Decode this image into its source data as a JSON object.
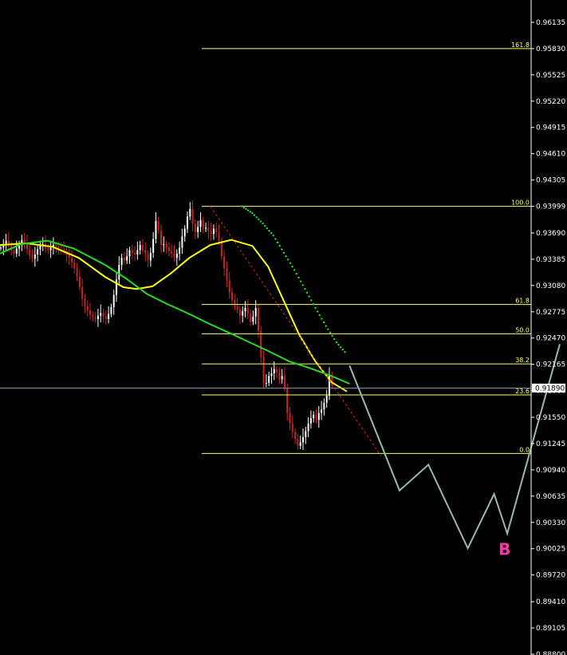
{
  "chart_data": {
    "type": "line",
    "title": "",
    "ylim": [
      0.8879,
      0.9644
    ],
    "xlim": [
      0,
      140
    ],
    "grid": false,
    "colors": {
      "background": "#000000",
      "axis": "#ffffff",
      "candle_up": "#ffffff",
      "candle_down": "#cc2222",
      "ma_yellow": "#ffff00",
      "ma_green": "#22dd22",
      "fib": "#ffff66",
      "projection": "#99bbaa",
      "trendline": "#cc2222",
      "current_price_line": "#8899bb",
      "wave_label": "#ff33aa"
    },
    "y_ticks": [
      "0.96135",
      "0.95830",
      "0.95525",
      "0.95220",
      "0.94915",
      "0.94610",
      "0.94305",
      "0.93999",
      "0.93690",
      "0.93385",
      "0.93080",
      "0.92775",
      "0.92470",
      "0.92165",
      "0.91860",
      "0.91550",
      "0.91245",
      "0.90940",
      "0.90635",
      "0.90330",
      "0.90025",
      "0.89720",
      "0.89410",
      "0.89105",
      "0.88800"
    ],
    "current_price": {
      "label": "0.91890",
      "value": 0.9189
    },
    "fib_levels": [
      {
        "label": "161.8",
        "value": 0.9583
      },
      {
        "label": "100.0",
        "value": 0.93999
      },
      {
        "label": "61.8",
        "value": 0.9286
      },
      {
        "label": "50.0",
        "value": 0.9252
      },
      {
        "label": "38.2",
        "value": 0.9217
      },
      {
        "label": "23.6",
        "value": 0.9181
      },
      {
        "label": "0.0",
        "value": 0.9113
      }
    ],
    "fib_x_range": [
      82,
      140
    ],
    "series": [
      {
        "kind": "candles",
        "x_start": 0,
        "closes": [
          0.9352,
          0.9356,
          0.936,
          0.9354,
          0.9349,
          0.9345,
          0.9351,
          0.9356,
          0.9361,
          0.9357,
          0.935,
          0.9343,
          0.9339,
          0.9344,
          0.935,
          0.9354,
          0.9356,
          0.9351,
          0.9349,
          0.9352,
          0.9355,
          0.9353,
          0.935,
          0.9349,
          0.9348,
          0.9344,
          0.934,
          0.9335,
          0.9328,
          0.9318,
          0.9306,
          0.9293,
          0.9284,
          0.9279,
          0.9274,
          0.9271,
          0.9269,
          0.9273,
          0.9276,
          0.9272,
          0.9269,
          0.9275,
          0.9283,
          0.9297,
          0.9315,
          0.9332,
          0.934,
          0.9337,
          0.9342,
          0.9349,
          0.9346,
          0.9344,
          0.9349,
          0.9355,
          0.9349,
          0.9345,
          0.9337,
          0.9346,
          0.9362,
          0.9383,
          0.9372,
          0.9355,
          0.9356,
          0.9352,
          0.9348,
          0.9345,
          0.934,
          0.9345,
          0.9352,
          0.9365,
          0.9374,
          0.9388,
          0.9397,
          0.938,
          0.937,
          0.9376,
          0.9384,
          0.9374,
          0.9375,
          0.9371,
          0.9368,
          0.9374,
          0.937,
          0.936,
          0.9342,
          0.9328,
          0.9314,
          0.93,
          0.9291,
          0.9284,
          0.928,
          0.9273,
          0.9278,
          0.9282,
          0.9275,
          0.9266,
          0.9272,
          0.9282,
          0.9255,
          0.9225,
          0.9195,
          0.9195,
          0.9203,
          0.9206,
          0.9211,
          0.9207,
          0.9199,
          0.9203,
          0.9189,
          0.916,
          0.9148,
          0.9138,
          0.913,
          0.9122,
          0.9126,
          0.9132,
          0.9139,
          0.9148,
          0.9154,
          0.9158,
          0.9152,
          0.916,
          0.9164,
          0.9172,
          0.918,
          0.9204,
          0.9192
        ]
      },
      {
        "kind": "ma",
        "name": "",
        "color": "ma_yellow",
        "x": [
          0,
          10,
          20,
          30,
          40,
          47,
          52,
          58,
          65,
          72,
          80,
          88,
          96,
          102,
          108,
          114,
          120,
          126,
          132
        ],
        "y": [
          0.9355,
          0.9357,
          0.9353,
          0.934,
          0.9318,
          0.9306,
          0.9304,
          0.9307,
          0.9322,
          0.934,
          0.9355,
          0.9361,
          0.9354,
          0.933,
          0.929,
          0.925,
          0.922,
          0.9196,
          0.9185
        ]
      },
      {
        "kind": "ma",
        "name": "",
        "color": "ma_green",
        "x": [
          0,
          8,
          18,
          28,
          40,
          48,
          56,
          64,
          72,
          80,
          88,
          95,
          102,
          110,
          118,
          126,
          133
        ],
        "y": [
          0.9345,
          0.9356,
          0.936,
          0.9351,
          0.9332,
          0.9316,
          0.9298,
          0.9286,
          0.9275,
          0.9263,
          0.9252,
          0.9242,
          0.9232,
          0.922,
          0.9212,
          0.9203,
          0.9194
        ]
      },
      {
        "kind": "psar",
        "name": "",
        "color": "ma_green",
        "x": [
          92,
          96,
          100,
          104,
          108,
          112,
          116,
          120,
          124,
          128,
          132
        ],
        "y": [
          0.94,
          0.9392,
          0.938,
          0.9366,
          0.9346,
          0.9326,
          0.9304,
          0.9282,
          0.9261,
          0.9242,
          0.9228
        ]
      },
      {
        "kind": "trendline",
        "name": "",
        "color": "trendline",
        "x": [
          80,
          145
        ],
        "y": [
          0.94,
          0.911
        ]
      },
      {
        "kind": "projection",
        "name": "",
        "color": "projection",
        "x": [
          133,
          152,
          163,
          178,
          188,
          193,
          213
        ],
        "y": [
          0.9215,
          0.907,
          0.91,
          0.9003,
          0.9066,
          0.902,
          0.924
        ]
      }
    ],
    "annotations": [
      {
        "label": "B",
        "x": 192,
        "y": 0.9002
      }
    ]
  }
}
